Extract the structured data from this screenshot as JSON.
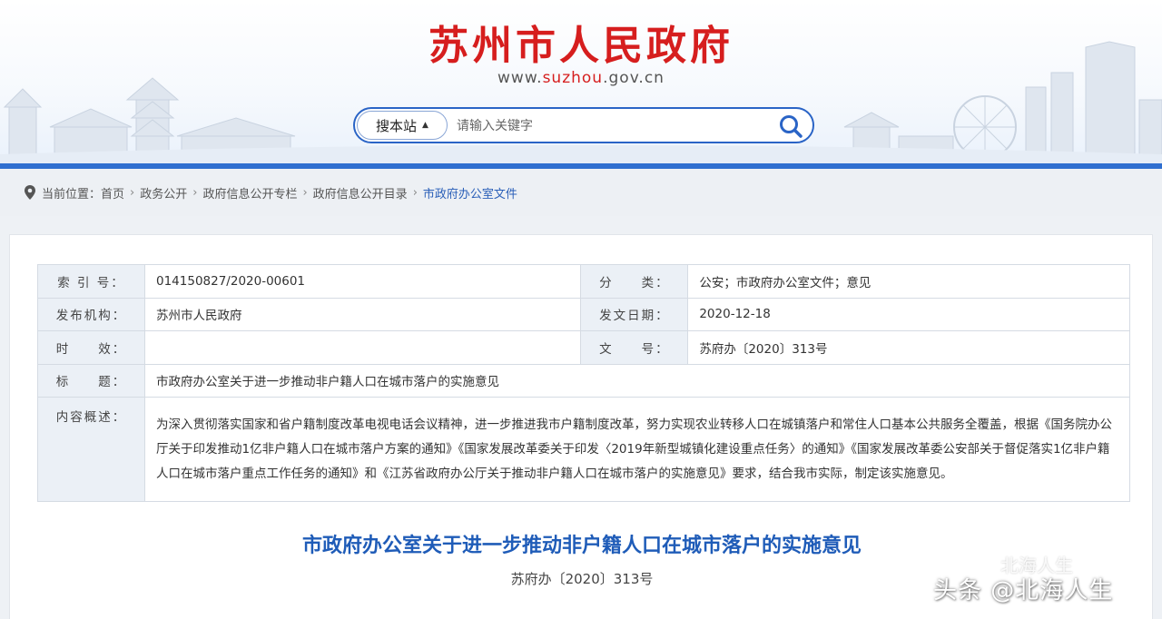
{
  "header": {
    "site_title": "苏州市人民政府",
    "site_url_prefix": "www.",
    "site_url_highlight": "suzhou",
    "site_url_suffix": ".gov.cn",
    "brand_color": "#d61e1e",
    "accent_color": "#2a64c6"
  },
  "search": {
    "scope_label": "搜本站",
    "scope_caret": "▲",
    "placeholder": "请输入关键字",
    "button_icon": "search-icon"
  },
  "breadcrumb": {
    "prefix": "当前位置：",
    "items": [
      "首页",
      "政务公开",
      "政府信息公开专栏",
      "政府信息公开目录",
      "市政府办公室文件"
    ],
    "separator": "›"
  },
  "info": {
    "index_label": "索 引 号：",
    "index_value": "014150827/2020-00601",
    "category_label": "分　　类：",
    "category_value": "公安；市政府办公室文件；意见",
    "issuer_label": "发布机构：",
    "issuer_value": "苏州市人民政府",
    "date_label": "发文日期：",
    "date_value": "2020-12-18",
    "validity_label": "时　　效：",
    "validity_value": "",
    "docno_label": "文　　号：",
    "docno_value": "苏府办〔2020〕313号",
    "title_label": "标　　题：",
    "title_value": "市政府办公室关于进一步推动非户籍人口在城市落户的实施意见",
    "summary_label": "内容概述：",
    "summary_value": "为深入贯彻落实国家和省户籍制度改革电视电话会议精神，进一步推进我市户籍制度改革，努力实现农业转移人口在城镇落户和常住人口基本公共服务全覆盖，根据《国务院办公厅关于印发推动1亿非户籍人口在城市落户方案的通知》《国家发展改革委关于印发〈2019年新型城镇化建设重点任务〉的通知》《国家发展改革委公安部关于督促落实1亿非户籍人口在城市落户重点工作任务的通知》和《江苏省政府办公厅关于推动非户籍人口在城市落户的实施意见》要求，结合我市实际，制定该实施意见。"
  },
  "document": {
    "title": "市政府办公室关于进一步推动非户籍人口在城市落户的实施意见",
    "number": "苏府办〔2020〕313号",
    "title_color": "#1f5cb8"
  },
  "watermark": {
    "small": "北海人生",
    "main": "头条 @北海人生"
  }
}
